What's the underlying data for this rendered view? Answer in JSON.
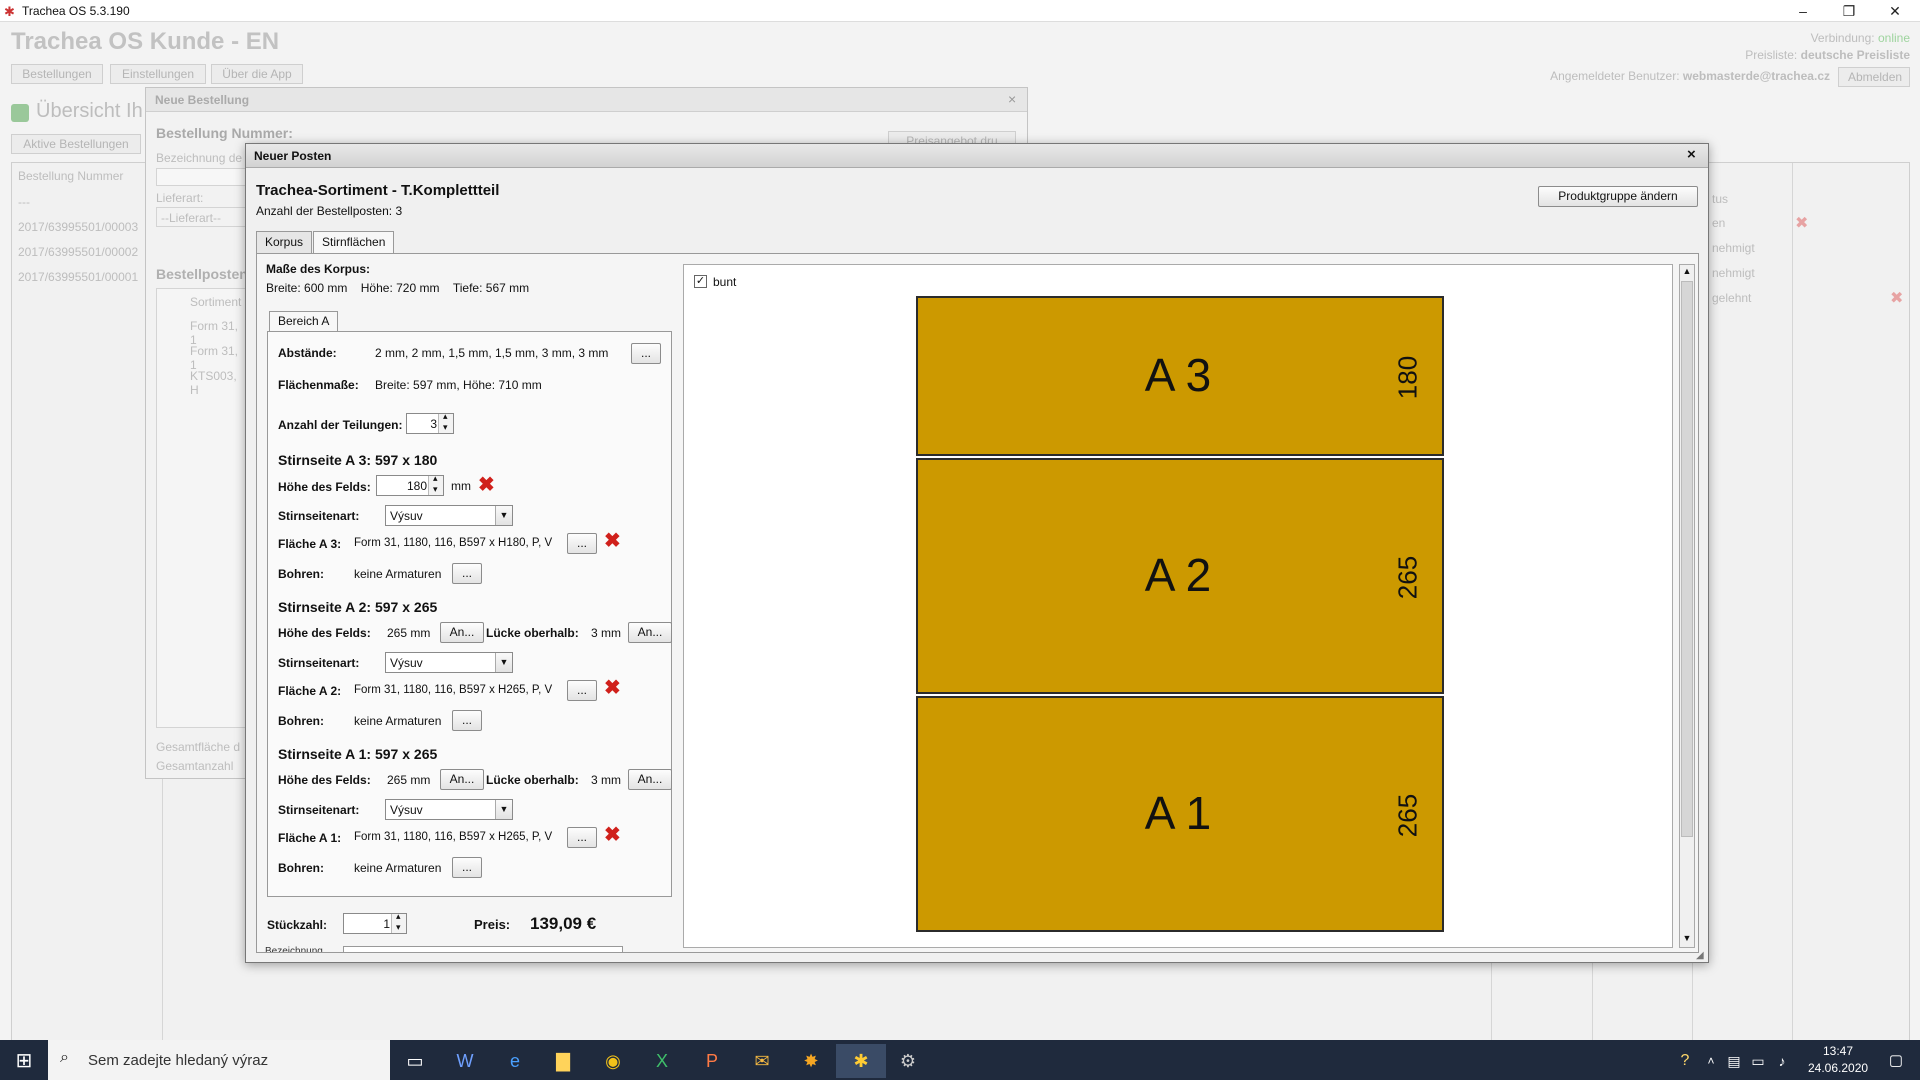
{
  "window": {
    "title": "Trachea OS 5.3.190"
  },
  "app": {
    "title": "Trachea OS Kunde - EN",
    "menu": [
      "Bestellungen",
      "Einstellungen",
      "Über die App"
    ],
    "status": {
      "verbindung_label": "Verbindung:",
      "verbindung_value": "online",
      "preisliste_label": "Preisliste:",
      "preisliste_value": "deutsche Preisliste",
      "user_label": "Angemeldeter Benutzer:",
      "user_value": "webmasterde@trachea.cz",
      "logout": "Abmelden"
    },
    "overview_title": "Übersicht Ih",
    "active_orders": "Aktive Bestellungen",
    "table": {
      "col1": "Bestellung Nummer",
      "status_col": "tus",
      "rows": [
        "---",
        "2017/63995501/00003",
        "2017/63995501/00002",
        "2017/63995501/00001"
      ],
      "status_rows": [
        "en",
        "nehmigt",
        "nehmigt",
        "gelehnt"
      ]
    }
  },
  "neue_bestellung": {
    "title": "Neue Bestellung",
    "nummer": "Bestellung Nummer:",
    "bezeichnung": "Bezeichnung de",
    "lieferart": "Lieferart:",
    "lieferart_value": "--Lieferart--",
    "preisangebot": "Preisangebot dru",
    "bestellposten": "Bestellposten",
    "sortiment": "Sortiment",
    "rows": [
      "Form 31, 1",
      "Form 31, 1",
      "KTS003, H"
    ],
    "gesamtflaeche": "Gesamtfläche d",
    "gesamtanzahl": "Gesamtanzahl"
  },
  "dialog": {
    "title": "Neuer Posten",
    "heading": "Trachea-Sortiment - T.Komplettteil",
    "anzahl_label": "Anzahl der Bestellposten:",
    "anzahl_value": "3",
    "produktgruppe_button": "Produktgruppe ändern",
    "tabs": [
      "Korpus",
      "Stirnflächen"
    ],
    "masse_title": "Maße des Korpus:",
    "breite_label": "Breite:",
    "breite_value": "600",
    "hoehe_label": "Höhe:",
    "hoehe_value": "720",
    "tiefe_label": "Tiefe:",
    "tiefe_value": "567",
    "unit": "mm",
    "bereich_tab": "Bereich A",
    "abstaende_label": "Abstände:",
    "abstaende_value": "2 mm, 2 mm, 1,5 mm, 1,5 mm, 3 mm, 3 mm",
    "flaechenmasse_label": "Flächenmaße:",
    "flaechenmasse_value": "Breite: 597 mm, Höhe: 710 mm",
    "teilungen_label": "Anzahl der Teilungen:",
    "teilungen_value": "3",
    "dots": "...",
    "an": "An...",
    "hoehe_felds_label": "Höhe des Felds:",
    "stirnseitenart_label": "Stirnseitenart:",
    "bohren_label": "Bohren:",
    "luecke_label": "Lücke oberhalb:",
    "sections": [
      {
        "title": "Stirnseite A 3: 597 x 180",
        "hoehe": "180",
        "art": "Výsuv",
        "flaeche_label": "Fläche A 3:",
        "flaeche_value": "Form 31, 1180, 116, B597 x H180, P, V",
        "bohren": "keine Armaturen"
      },
      {
        "title": "Stirnseite A 2: 597 x 265",
        "hoehe": "265 mm",
        "luecke": "3 mm",
        "art": "Výsuv",
        "flaeche_label": "Fläche A 2:",
        "flaeche_value": "Form 31, 1180, 116, B597 x H265, P, V",
        "bohren": "keine Armaturen"
      },
      {
        "title": "Stirnseite A 1: 597 x 265",
        "hoehe": "265 mm",
        "luecke": "3 mm",
        "art": "Výsuv",
        "flaeche_label": "Fläche A 1:",
        "flaeche_value": "Form 31, 1180, 116, B597 x H265, P, V",
        "bohren": "keine Armaturen"
      }
    ],
    "stueckzahl_label": "Stückzahl:",
    "stueckzahl_value": "1",
    "preis_label": "Preis:",
    "preis_value": "139,09 €",
    "bezeichnung_cut": "Bezeichnung",
    "bunt": "bunt",
    "preview": [
      {
        "name": "A 3",
        "height": "180",
        "mm": 180
      },
      {
        "name": "A 2",
        "height": "265",
        "mm": 265
      },
      {
        "name": "A 1",
        "height": "265",
        "mm": 265
      }
    ],
    "field_color": "#cc9900"
  },
  "taskbar": {
    "search": "Sem zadejte hledaný výraz",
    "time": "13:47",
    "date": "24.06.2020"
  }
}
